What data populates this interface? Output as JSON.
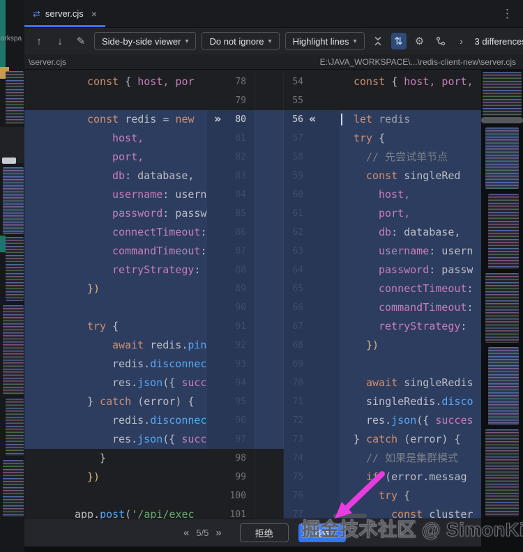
{
  "tab_bar": {
    "tab_title": "server.cjs"
  },
  "toolbar": {
    "viewer_dropdown": "Side-by-side viewer",
    "ignore_dropdown": "Do not ignore",
    "highlight_dropdown": "Highlight lines",
    "differences_label": "3 differences"
  },
  "breadcrumbs": {
    "left_path": "\\server.cjs",
    "right_path": "E:\\JAVA_WORKSPACE\\...\\redis-client-new\\server.cjs"
  },
  "background": {
    "partial_text": "orkspa"
  },
  "bottom_bar": {
    "position": "5/5",
    "reject_label": "拒绝",
    "accept_label": "接受"
  },
  "watermark": {
    "text": "掘金技术社区 @ SimonKing"
  },
  "icons": {
    "tab_diff": "⇄",
    "close": "×",
    "kebab": "⋮",
    "up_arrow": "↑",
    "down_arrow": "↓",
    "pencil": "✎",
    "caret": "▾",
    "gear": "⚙",
    "sync_scroll": "⇅",
    "chevron_right": "›",
    "nav_prev": "«",
    "nav_next": "»"
  },
  "colors": {
    "accent_blue": "#3574f0",
    "changed_line_bg": "#2d3d60",
    "keyword": "#cf8e6d",
    "property": "#c77dbb",
    "function_call": "#56a8f5",
    "comment": "#7a7e85",
    "string": "#6aab73",
    "arrow_magenta": "#e93ce0"
  },
  "diff": {
    "rows": [
      {
        "l": {
          "n": "78",
          "i": 2,
          "bg": 0,
          "nv": 1,
          "tk": [
            [
              "k",
              "const "
            ],
            [
              "t",
              "{ "
            ],
            [
              "p",
              "host, por"
            ]
          ]
        },
        "m": 0,
        "r": {
          "n": "54",
          "i": 2,
          "bg": 0,
          "nv": 1,
          "tk": [
            [
              "k",
              "const "
            ],
            [
              "t",
              "{ "
            ],
            [
              "p",
              "host, port,"
            ]
          ]
        }
      },
      {
        "l": {
          "n": "79",
          "i": 0,
          "bg": 0,
          "nv": 1,
          "tk": []
        },
        "m": 0,
        "r": {
          "n": "55",
          "i": 0,
          "bg": 0,
          "nv": 1,
          "tk": []
        }
      },
      {
        "l": {
          "n": "80",
          "i": 2,
          "bg": 1,
          "nv": 1,
          "cur": 1,
          "mk": "»",
          "tk": [
            [
              "k",
              "const "
            ],
            [
              "t",
              "redis = "
            ],
            [
              "k",
              "new"
            ]
          ]
        },
        "m": 1,
        "r": {
          "n": "56",
          "i": 2,
          "bg": 1,
          "nv": 1,
          "cur": 1,
          "mk": "«",
          "cursor": 1,
          "tk": [
            [
              "k",
              "let "
            ],
            [
              "d",
              "redis"
            ]
          ]
        }
      },
      {
        "l": {
          "n": "81",
          "i": 6,
          "bg": 1,
          "nv": 0,
          "tk": [
            [
              "p",
              "host,"
            ]
          ]
        },
        "m": 1,
        "r": {
          "n": "57",
          "i": 2,
          "bg": 1,
          "nv": 0,
          "tk": [
            [
              "k",
              "try "
            ],
            [
              "t",
              "{"
            ]
          ]
        }
      },
      {
        "l": {
          "n": "82",
          "i": 6,
          "bg": 1,
          "nv": 0,
          "tk": [
            [
              "p",
              "port,"
            ]
          ]
        },
        "m": 1,
        "r": {
          "n": "58",
          "i": 4,
          "bg": 1,
          "nv": 0,
          "tk": [
            [
              "c",
              "// 先尝试单节点"
            ]
          ]
        }
      },
      {
        "l": {
          "n": "83",
          "i": 6,
          "bg": 1,
          "nv": 0,
          "tk": [
            [
              "p",
              "db"
            ],
            [
              "t",
              ": database,"
            ]
          ]
        },
        "m": 1,
        "r": {
          "n": "59",
          "i": 4,
          "bg": 1,
          "nv": 0,
          "tk": [
            [
              "k",
              "const "
            ],
            [
              "t",
              "singleRed"
            ]
          ]
        }
      },
      {
        "l": {
          "n": "84",
          "i": 6,
          "bg": 1,
          "nv": 0,
          "tk": [
            [
              "p",
              "username"
            ],
            [
              "t",
              ": usern"
            ]
          ]
        },
        "m": 1,
        "r": {
          "n": "60",
          "i": 6,
          "bg": 1,
          "nv": 0,
          "tk": [
            [
              "p",
              "host,"
            ]
          ]
        }
      },
      {
        "l": {
          "n": "85",
          "i": 6,
          "bg": 1,
          "nv": 0,
          "tk": [
            [
              "p",
              "password"
            ],
            [
              "t",
              ": passw"
            ]
          ]
        },
        "m": 1,
        "r": {
          "n": "61",
          "i": 6,
          "bg": 1,
          "nv": 0,
          "tk": [
            [
              "p",
              "port,"
            ]
          ]
        }
      },
      {
        "l": {
          "n": "86",
          "i": 6,
          "bg": 1,
          "nv": 0,
          "tk": [
            [
              "p",
              "connectTimeout"
            ],
            [
              "t",
              ":"
            ]
          ]
        },
        "m": 1,
        "r": {
          "n": "62",
          "i": 6,
          "bg": 1,
          "nv": 0,
          "tk": [
            [
              "p",
              "db"
            ],
            [
              "t",
              ": database,"
            ]
          ]
        }
      },
      {
        "l": {
          "n": "87",
          "i": 6,
          "bg": 1,
          "nv": 0,
          "tk": [
            [
              "p",
              "commandTimeout"
            ],
            [
              "t",
              ":"
            ]
          ]
        },
        "m": 1,
        "r": {
          "n": "63",
          "i": 6,
          "bg": 1,
          "nv": 0,
          "tk": [
            [
              "p",
              "username"
            ],
            [
              "t",
              ": usern"
            ]
          ]
        }
      },
      {
        "l": {
          "n": "88",
          "i": 6,
          "bg": 1,
          "nv": 0,
          "tk": [
            [
              "p",
              "retryStrategy"
            ],
            [
              "t",
              ":"
            ]
          ]
        },
        "m": 1,
        "r": {
          "n": "64",
          "i": 6,
          "bg": 1,
          "nv": 0,
          "tk": [
            [
              "p",
              "password"
            ],
            [
              "t",
              ": passw"
            ]
          ]
        }
      },
      {
        "l": {
          "n": "89",
          "i": 2,
          "bg": 1,
          "nv": 0,
          "tk": [
            [
              "g",
              "})"
            ]
          ]
        },
        "m": 1,
        "r": {
          "n": "65",
          "i": 6,
          "bg": 1,
          "nv": 0,
          "tk": [
            [
              "p",
              "connectTimeout"
            ],
            [
              "t",
              ":"
            ]
          ]
        }
      },
      {
        "l": {
          "n": "90",
          "i": 0,
          "bg": 1,
          "nv": 0,
          "tk": []
        },
        "m": 1,
        "r": {
          "n": "66",
          "i": 6,
          "bg": 1,
          "nv": 0,
          "tk": [
            [
              "p",
              "commandTimeout"
            ],
            [
              "t",
              ":"
            ]
          ]
        }
      },
      {
        "l": {
          "n": "91",
          "i": 2,
          "bg": 1,
          "nv": 0,
          "tk": [
            [
              "k",
              "try "
            ],
            [
              "t",
              "{"
            ]
          ]
        },
        "m": 1,
        "r": {
          "n": "67",
          "i": 6,
          "bg": 1,
          "nv": 0,
          "tk": [
            [
              "p",
              "retryStrategy"
            ],
            [
              "t",
              ":"
            ]
          ]
        }
      },
      {
        "l": {
          "n": "92",
          "i": 6,
          "bg": 1,
          "nv": 0,
          "tk": [
            [
              "k",
              "await "
            ],
            [
              "t",
              "redis."
            ],
            [
              "f",
              "pin"
            ]
          ]
        },
        "m": 1,
        "r": {
          "n": "68",
          "i": 4,
          "bg": 1,
          "nv": 0,
          "tk": [
            [
              "g",
              "})"
            ]
          ]
        }
      },
      {
        "l": {
          "n": "93",
          "i": 6,
          "bg": 1,
          "nv": 0,
          "tk": [
            [
              "t",
              "redis."
            ],
            [
              "f",
              "disconnec"
            ]
          ]
        },
        "m": 1,
        "r": {
          "n": "69",
          "i": 0,
          "bg": 1,
          "nv": 0,
          "tk": []
        }
      },
      {
        "l": {
          "n": "94",
          "i": 6,
          "bg": 1,
          "nv": 0,
          "tk": [
            [
              "t",
              "res."
            ],
            [
              "f",
              "json"
            ],
            [
              "t",
              "({ "
            ],
            [
              "p",
              "succ"
            ]
          ]
        },
        "m": 1,
        "r": {
          "n": "70",
          "i": 4,
          "bg": 1,
          "nv": 0,
          "tk": [
            [
              "k",
              "await "
            ],
            [
              "t",
              "singleRedis"
            ]
          ]
        }
      },
      {
        "l": {
          "n": "95",
          "i": 2,
          "bg": 1,
          "nv": 0,
          "tk": [
            [
              "t",
              "} "
            ],
            [
              "k",
              "catch "
            ],
            [
              "t",
              "(error) {"
            ]
          ]
        },
        "m": 1,
        "r": {
          "n": "71",
          "i": 4,
          "bg": 1,
          "nv": 0,
          "tk": [
            [
              "t",
              "singleRedis."
            ],
            [
              "f",
              "disco"
            ]
          ]
        }
      },
      {
        "l": {
          "n": "96",
          "i": 6,
          "bg": 1,
          "nv": 0,
          "tk": [
            [
              "t",
              "redis."
            ],
            [
              "f",
              "disconnec"
            ]
          ]
        },
        "m": 1,
        "r": {
          "n": "72",
          "i": 4,
          "bg": 1,
          "nv": 0,
          "tk": [
            [
              "t",
              "res."
            ],
            [
              "f",
              "json"
            ],
            [
              "t",
              "({ "
            ],
            [
              "p",
              "succes"
            ]
          ]
        }
      },
      {
        "l": {
          "n": "97",
          "i": 6,
          "bg": 1,
          "nv": 0,
          "tk": [
            [
              "t",
              "res."
            ],
            [
              "f",
              "json"
            ],
            [
              "t",
              "({ "
            ],
            [
              "p",
              "succ"
            ]
          ]
        },
        "m": 1,
        "r": {
          "n": "73",
          "i": 2,
          "bg": 1,
          "nv": 0,
          "tk": [
            [
              "t",
              "} "
            ],
            [
              "k",
              "catch "
            ],
            [
              "t",
              "(error) {"
            ]
          ]
        }
      },
      {
        "l": {
          "n": "98",
          "i": 4,
          "bg": 0,
          "nv": 1,
          "tk": [
            [
              "t",
              "}"
            ]
          ]
        },
        "m": 0,
        "r": {
          "n": "74",
          "i": 4,
          "bg": 1,
          "nv": 0,
          "tk": [
            [
              "c",
              "// 如果是集群模式"
            ]
          ]
        }
      },
      {
        "l": {
          "n": "99",
          "i": 2,
          "bg": 0,
          "nv": 1,
          "tk": [
            [
              "g",
              "})"
            ]
          ]
        },
        "m": 0,
        "r": {
          "n": "75",
          "i": 4,
          "bg": 1,
          "nv": 0,
          "tk": [
            [
              "k",
              "if "
            ],
            [
              "t",
              "(error.messag"
            ]
          ]
        }
      },
      {
        "l": {
          "n": "100",
          "i": 0,
          "bg": 0,
          "nv": 1,
          "tk": []
        },
        "m": 0,
        "r": {
          "n": "76",
          "i": 6,
          "bg": 1,
          "nv": 0,
          "tk": [
            [
              "k",
              "try "
            ],
            [
              "t",
              "{"
            ]
          ]
        }
      },
      {
        "l": {
          "n": "101",
          "i": 0,
          "bg": 0,
          "nv": 1,
          "tk": [
            [
              "t",
              "app."
            ],
            [
              "f",
              "post"
            ],
            [
              "t",
              "("
            ],
            [
              "s",
              "'/api/exec"
            ]
          ]
        },
        "m": 0,
        "r": {
          "n": "77",
          "i": 8,
          "bg": 1,
          "nv": 0,
          "tk": [
            [
              "k",
              "const "
            ],
            [
              "t",
              "cluster"
            ]
          ]
        }
      }
    ]
  }
}
